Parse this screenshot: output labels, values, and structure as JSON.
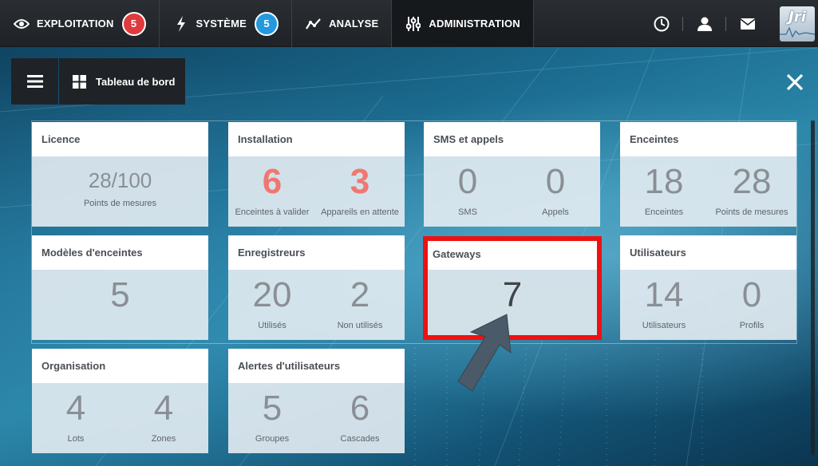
{
  "nav": {
    "items": [
      {
        "label": "EXPLOITATION",
        "icon": "eye-icon",
        "badge": "5",
        "badge_color": "#e0393e"
      },
      {
        "label": "SYSTÈME",
        "icon": "lightning-icon",
        "badge": "5",
        "badge_color": "#2399de"
      },
      {
        "label": "ANALYSE",
        "icon": "line-chart-icon"
      },
      {
        "label": "ADMINISTRATION",
        "icon": "sliders-icon",
        "active": true
      }
    ],
    "right_icons": [
      "clock-icon",
      "user-icon",
      "mail-icon"
    ],
    "logo_text": "Jri"
  },
  "subbar": {
    "menu_icon": "hamburger-icon",
    "title_icon": "dashboard-grid-icon",
    "title": "Tableau de bord",
    "close_icon": "close-icon"
  },
  "cards": {
    "licence": {
      "title": "Licence",
      "m1_value": "28/100",
      "m1_label": "Points de mesures"
    },
    "installation": {
      "title": "Installation",
      "m1_value": "6",
      "m1_label": "Enceintes à valider",
      "m2_value": "3",
      "m2_label": "Appareils en attente"
    },
    "sms": {
      "title": "SMS et appels",
      "m1_value": "0",
      "m1_label": "SMS",
      "m2_value": "0",
      "m2_label": "Appels"
    },
    "enceintes": {
      "title": "Enceintes",
      "m1_value": "18",
      "m1_label": "Enceintes",
      "m2_value": "28",
      "m2_label": "Points de mesures"
    },
    "modeles": {
      "title": "Modèles d'enceintes",
      "m1_value": "5"
    },
    "enregistreurs": {
      "title": "Enregistreurs",
      "m1_value": "20",
      "m1_label": "Utilisés",
      "m2_value": "2",
      "m2_label": "Non utilisés"
    },
    "gateways": {
      "title": "Gateways",
      "m1_value": "7"
    },
    "utilisateurs": {
      "title": "Utilisateurs",
      "m1_value": "14",
      "m1_label": "Utilisateurs",
      "m2_value": "0",
      "m2_label": "Profils"
    },
    "organisation": {
      "title": "Organisation",
      "m1_value": "4",
      "m1_label": "Lots",
      "m2_value": "4",
      "m2_label": "Zones"
    },
    "alertes": {
      "title": "Alertes d'utilisateurs",
      "m1_value": "5",
      "m1_label": "Groupes",
      "m2_value": "6",
      "m2_label": "Cascades"
    }
  },
  "colors": {
    "accent_value": "#f07770",
    "highlight": "#ee1111",
    "arrow": "#4a5a68"
  }
}
